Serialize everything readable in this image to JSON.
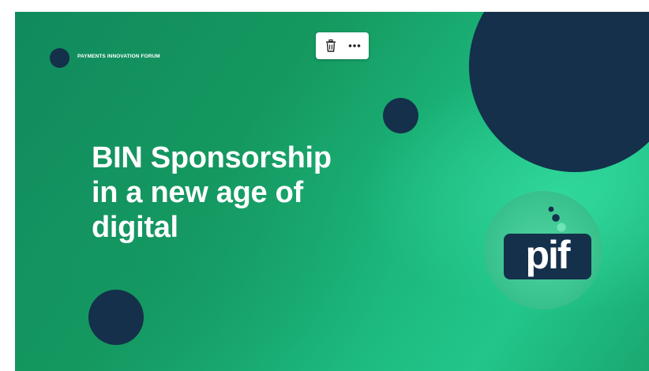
{
  "slide": {
    "brand_name": "PAYMENTS INNOVATION FORUM",
    "headline_lines": [
      "BIN Sponsorship",
      "in a new age of",
      "digital"
    ],
    "logo_text": "pif"
  },
  "toolbar": {
    "items": [
      {
        "name": "delete",
        "icon": "trash-icon"
      },
      {
        "name": "more",
        "icon": "more-horizontal-icon"
      }
    ]
  },
  "colors": {
    "navy": "#14304a",
    "green_dark": "#108a5e",
    "green_light": "#22c68a",
    "logo_disc": "#3cc590",
    "white": "#ffffff"
  }
}
